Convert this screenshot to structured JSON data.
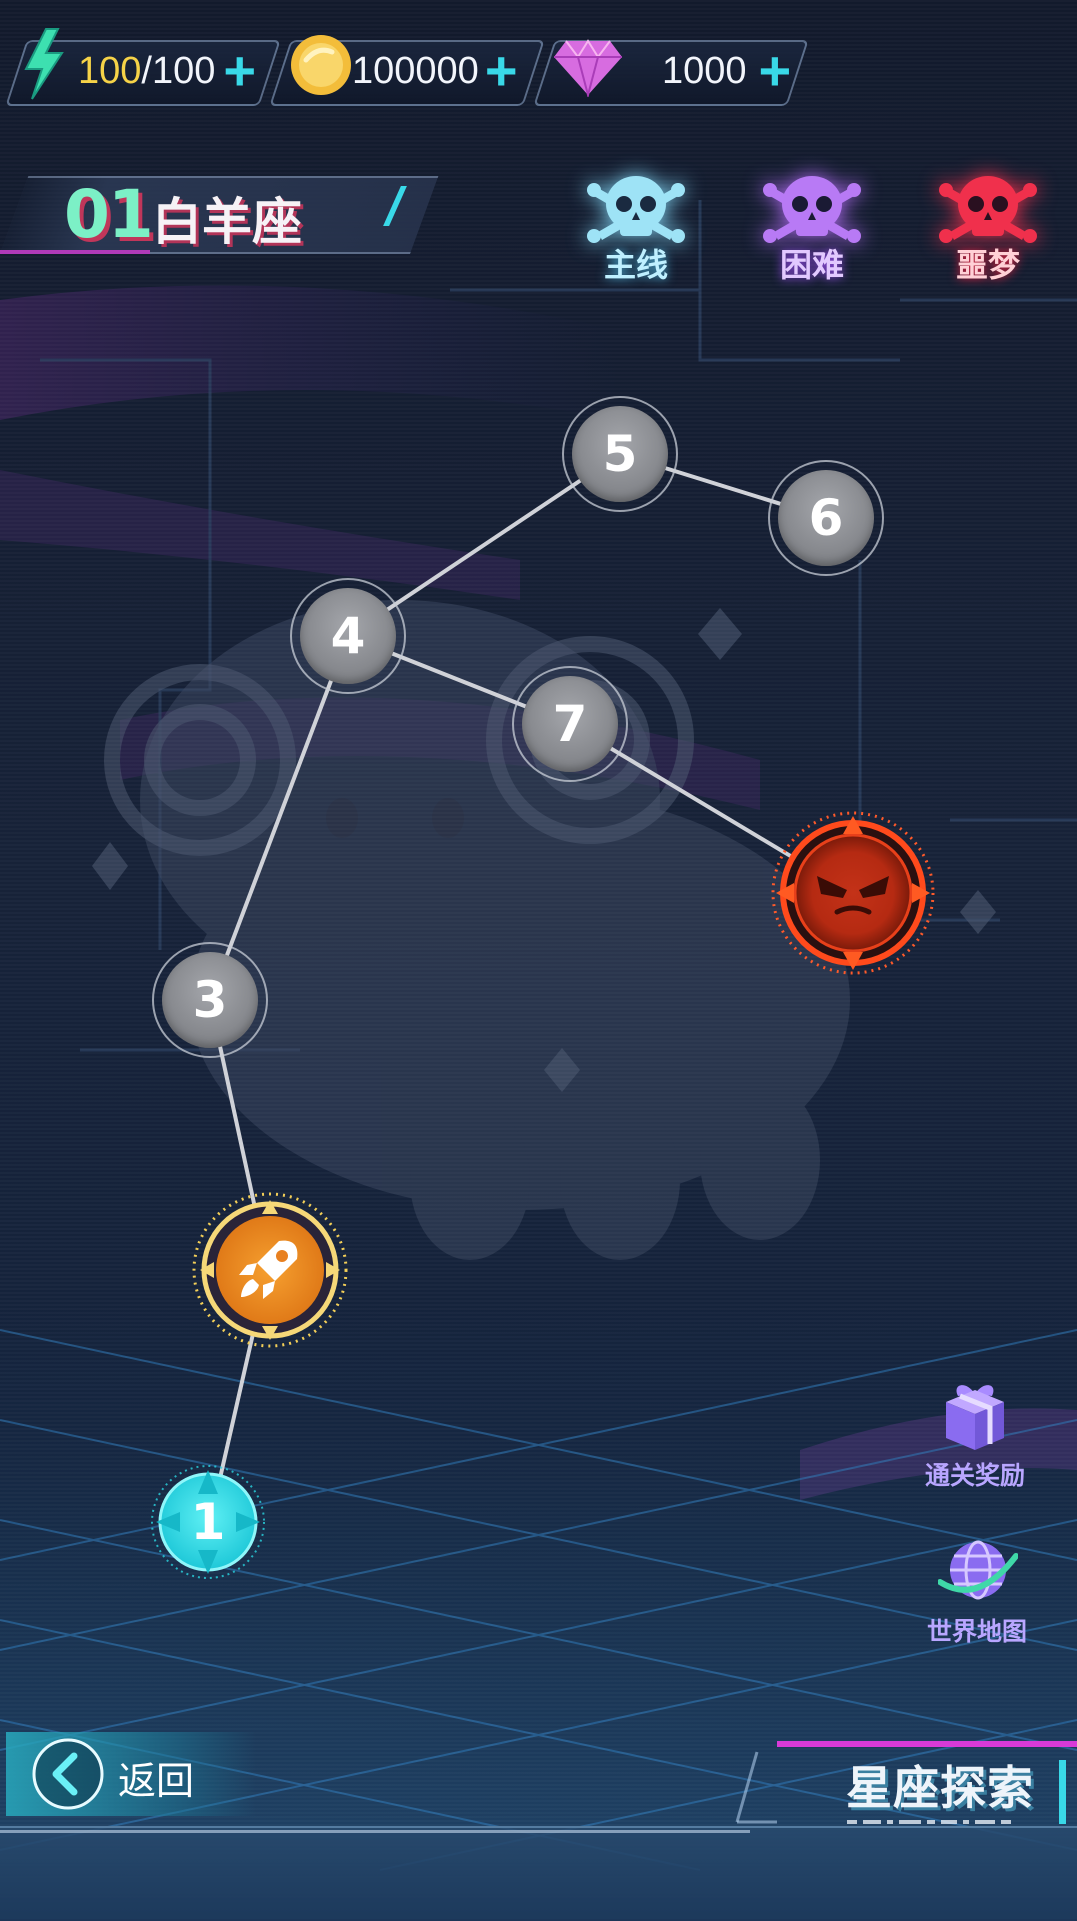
{
  "resources": {
    "energy": {
      "icon": "lightning-icon",
      "current": "100",
      "max": "100",
      "separator": "/"
    },
    "coins": {
      "icon": "coin-icon",
      "value": "100000"
    },
    "gems": {
      "icon": "gem-icon",
      "value": "1000"
    },
    "add_label": "+"
  },
  "stage": {
    "number": "01",
    "name": "白羊座"
  },
  "difficulty_tabs": [
    {
      "label": "主线",
      "icon": "skull-crossbones-icon",
      "color": "#7fd2f0"
    },
    {
      "label": "困难",
      "icon": "skull-crossbones-icon",
      "color": "#b36cf5"
    },
    {
      "label": "噩梦",
      "icon": "skull-crossbones-icon",
      "color": "#f0304c"
    }
  ],
  "levels": [
    {
      "label": "1",
      "state": "current"
    },
    {
      "label": "",
      "state": "special",
      "icon": "rocket-icon"
    },
    {
      "label": "3",
      "state": "locked"
    },
    {
      "label": "4",
      "state": "locked"
    },
    {
      "label": "5",
      "state": "locked"
    },
    {
      "label": "6",
      "state": "locked"
    },
    {
      "label": "7",
      "state": "locked"
    },
    {
      "label": "",
      "state": "boss",
      "icon": "angry-face-icon"
    }
  ],
  "side_buttons": {
    "rewards": {
      "label": "通关奖励",
      "icon": "gift-icon"
    },
    "world_map": {
      "label": "世界地图",
      "icon": "globe-icon"
    }
  },
  "footer": {
    "back_label": "返回",
    "mode_title": "星座探索"
  },
  "colors": {
    "accent_cyan": "#39d9e8",
    "node_gray": "#8a8c91",
    "boss_red": "#d8391a",
    "rocket_orange": "#f08a20"
  }
}
